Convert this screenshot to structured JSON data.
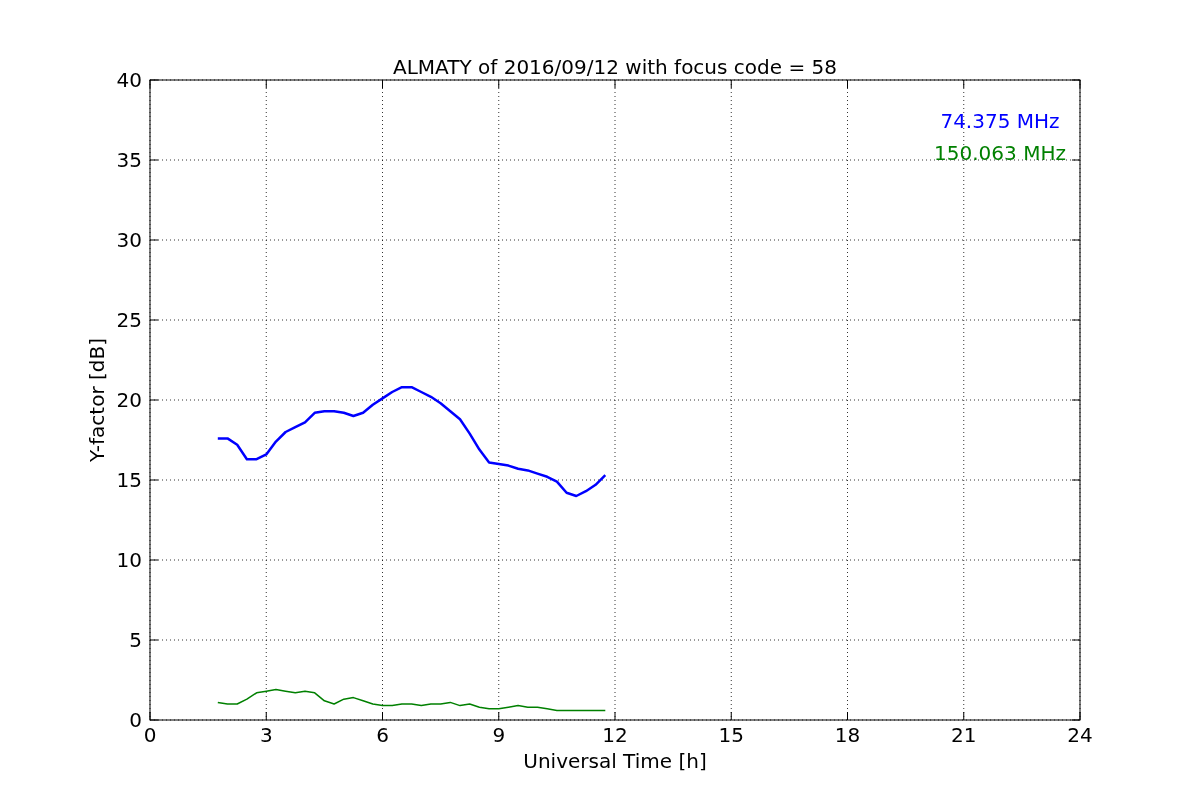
{
  "chart": {
    "chart_data": {
      "type": "line",
      "title": "ALMATY of 2016/09/12 with focus code = 58",
      "xlabel": "Universal Time [h]",
      "ylabel": "Y-factor [dB]",
      "x": [
        1.75,
        2.0,
        2.25,
        2.5,
        2.75,
        3.0,
        3.25,
        3.5,
        3.75,
        4.0,
        4.25,
        4.5,
        4.75,
        5.0,
        5.25,
        5.5,
        5.75,
        6.0,
        6.25,
        6.5,
        6.75,
        7.0,
        7.25,
        7.5,
        7.75,
        8.0,
        8.25,
        8.5,
        8.75,
        9.0,
        9.25,
        9.5,
        9.75,
        10.0,
        10.25,
        10.5,
        10.75,
        11.0,
        11.25,
        11.5,
        11.75
      ],
      "series": [
        {
          "name": "74.375 MHz",
          "color": "#0000ff",
          "values": [
            17.6,
            17.6,
            17.2,
            16.3,
            16.3,
            16.6,
            17.4,
            18.0,
            18.3,
            18.6,
            19.2,
            19.3,
            19.3,
            19.2,
            19.0,
            19.2,
            19.7,
            20.1,
            20.5,
            20.8,
            20.8,
            20.5,
            20.2,
            19.8,
            19.3,
            18.8,
            17.9,
            16.9,
            16.1,
            16.0,
            15.9,
            15.7,
            15.6,
            15.4,
            15.2,
            14.9,
            14.2,
            14.0,
            14.3,
            14.7,
            15.3
          ]
        },
        {
          "name": "150.063 MHz",
          "color": "#008000",
          "values": [
            1.1,
            1.0,
            1.0,
            1.3,
            1.7,
            1.8,
            1.9,
            1.8,
            1.7,
            1.8,
            1.7,
            1.2,
            1.0,
            1.3,
            1.4,
            1.2,
            1.0,
            0.9,
            0.9,
            1.0,
            1.0,
            0.9,
            1.0,
            1.0,
            1.1,
            0.9,
            1.0,
            0.8,
            0.7,
            0.7,
            0.8,
            0.9,
            0.8,
            0.8,
            0.7,
            0.6,
            0.6,
            0.6,
            0.6,
            0.6,
            0.6
          ]
        }
      ],
      "grid": true,
      "xlim": [
        0,
        24
      ],
      "ylim": [
        0,
        40
      ],
      "xticks": [
        0,
        3,
        6,
        9,
        12,
        15,
        18,
        21,
        24
      ],
      "yticks": [
        0,
        5,
        10,
        15,
        20,
        25,
        30,
        35,
        40
      ]
    }
  }
}
